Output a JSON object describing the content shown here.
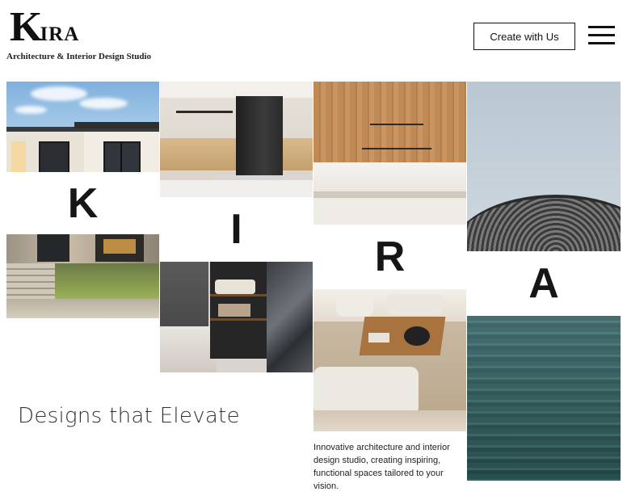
{
  "brand": {
    "logo_initial": "K",
    "logo_rest": "IRA",
    "tagline": "Architecture & Interior Design Studio"
  },
  "header": {
    "cta_label": "Create with Us",
    "menu_icon": "hamburger-menu-icon"
  },
  "mosaic": {
    "letters": [
      "K",
      "I",
      "R",
      "A"
    ]
  },
  "hero": {
    "heading": "Designs that Elevate",
    "description": "Innovative architecture and interior design studio, creating inspiring, functional spaces tailored to your vision."
  }
}
